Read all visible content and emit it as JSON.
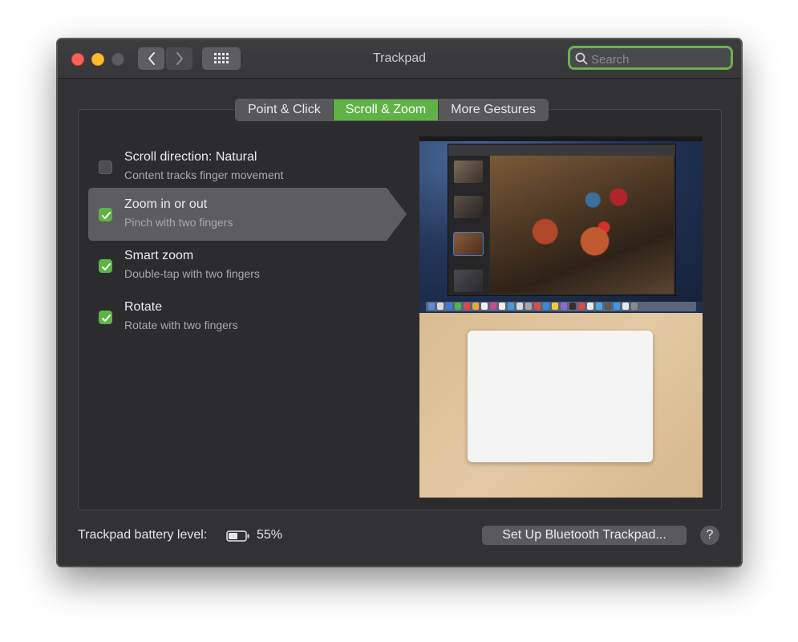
{
  "window": {
    "title": "Trackpad"
  },
  "search": {
    "placeholder": "Search",
    "value": ""
  },
  "tabs": [
    {
      "label": "Point & Click",
      "active": false
    },
    {
      "label": "Scroll & Zoom",
      "active": true
    },
    {
      "label": "More Gestures",
      "active": false
    }
  ],
  "options": [
    {
      "title": "Scroll direction: Natural",
      "subtitle": "Content tracks finger movement",
      "checked": false,
      "selected": false
    },
    {
      "title": "Zoom in or out",
      "subtitle": "Pinch with two fingers",
      "checked": true,
      "selected": true
    },
    {
      "title": "Smart zoom",
      "subtitle": "Double-tap with two fingers",
      "checked": true,
      "selected": false
    },
    {
      "title": "Rotate",
      "subtitle": "Rotate with two fingers",
      "checked": true,
      "selected": false
    }
  ],
  "footer": {
    "battery_label": "Trackpad battery level:",
    "battery_percent": "55%",
    "battery_level": 0.55,
    "setup_button": "Set Up Bluetooth Trackpad...",
    "help_label": "?"
  },
  "colors": {
    "accent": "#5fb246",
    "close": "#fe5f57",
    "minimize": "#febc2e",
    "window_bg": "#323235"
  },
  "icons": [
    "back-chevron-icon",
    "forward-chevron-icon",
    "grid-icon",
    "search-icon",
    "checkmark-icon",
    "battery-icon"
  ]
}
